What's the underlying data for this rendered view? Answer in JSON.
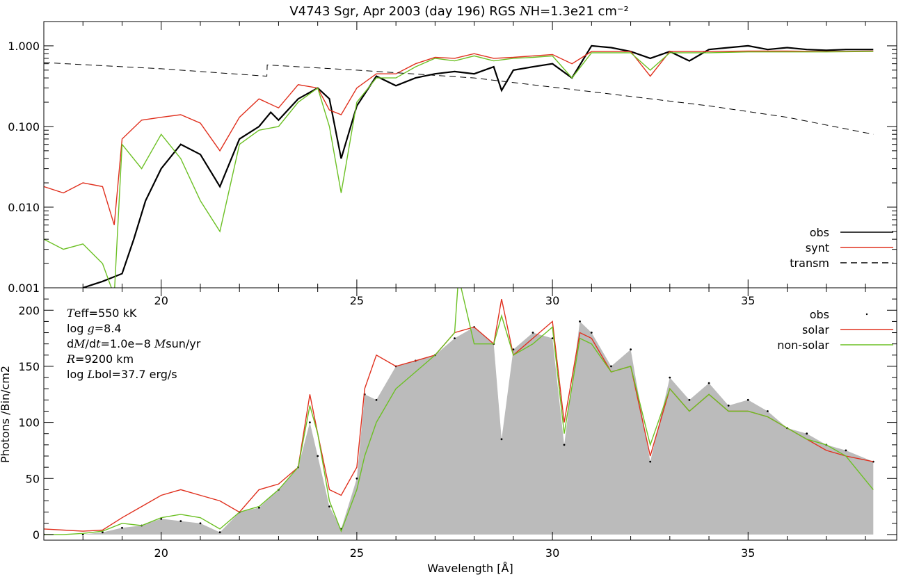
{
  "chart_data": [
    {
      "type": "line",
      "title": "V4743 Sgr, Apr 2003 (day 196) RGS  NH=1.3e21 cm⁻²",
      "title_parts": {
        "prefix": "V4743 Sgr, Apr 2003 (day 196) RGS  ",
        "sym": "N",
        "rest": "H=1.3e21 cm⁻²"
      },
      "xlabel": "",
      "ylabel": "",
      "xlim": [
        17,
        38.8
      ],
      "ylim": [
        0.001,
        2.0
      ],
      "yscale": "log",
      "xticks": [
        20,
        25,
        30,
        35
      ],
      "xtick_labels": [
        "20",
        "25",
        "30",
        "35"
      ],
      "yticks": [
        0.001,
        0.01,
        0.1,
        1.0
      ],
      "ytick_labels": [
        "0.001",
        "0.010",
        "0.100",
        "1.000"
      ],
      "grid": false,
      "legend_position": "bottom-right",
      "series": [
        {
          "name": "obs",
          "color": "#000000",
          "style": "solid",
          "x": [
            18.0,
            18.5,
            19.0,
            19.3,
            19.6,
            20.0,
            20.5,
            21.0,
            21.5,
            22.0,
            22.5,
            22.8,
            23.0,
            23.5,
            24.0,
            24.3,
            24.6,
            25.0,
            25.5,
            26.0,
            26.5,
            27.0,
            27.5,
            28.0,
            28.5,
            28.7,
            29.0,
            29.5,
            30.0,
            30.5,
            31.0,
            31.5,
            32.0,
            32.5,
            33.0,
            33.5,
            34.0,
            34.5,
            35.0,
            35.5,
            36.0,
            36.5,
            37.0,
            37.5,
            38.2
          ],
          "values": [
            0.001,
            0.0012,
            0.0015,
            0.004,
            0.012,
            0.03,
            0.06,
            0.045,
            0.018,
            0.07,
            0.1,
            0.15,
            0.12,
            0.22,
            0.3,
            0.22,
            0.04,
            0.18,
            0.42,
            0.32,
            0.4,
            0.45,
            0.48,
            0.45,
            0.55,
            0.28,
            0.5,
            0.55,
            0.6,
            0.4,
            1.0,
            0.95,
            0.85,
            0.7,
            0.85,
            0.65,
            0.9,
            0.95,
            1.0,
            0.9,
            0.95,
            0.9,
            0.88,
            0.9,
            0.9
          ]
        },
        {
          "name": "synt",
          "color": "#e0301e",
          "style": "solid",
          "x": [
            17.0,
            17.5,
            18.0,
            18.5,
            18.8,
            19.0,
            19.5,
            20.0,
            20.5,
            21.0,
            21.5,
            22.0,
            22.5,
            23.0,
            23.5,
            24.0,
            24.3,
            24.6,
            25.0,
            25.5,
            26.0,
            26.5,
            27.0,
            27.5,
            28.0,
            28.5,
            29.0,
            29.5,
            30.0,
            30.5,
            31.0,
            32.0,
            32.5,
            33.0,
            34.0,
            35.0,
            36.0,
            37.0,
            38.2
          ],
          "values": [
            0.018,
            0.015,
            0.02,
            0.018,
            0.006,
            0.07,
            0.12,
            0.13,
            0.14,
            0.11,
            0.05,
            0.13,
            0.22,
            0.17,
            0.33,
            0.3,
            0.16,
            0.14,
            0.3,
            0.45,
            0.45,
            0.6,
            0.72,
            0.7,
            0.8,
            0.7,
            0.72,
            0.75,
            0.78,
            0.6,
            0.85,
            0.85,
            0.42,
            0.85,
            0.85,
            0.86,
            0.86,
            0.85,
            0.86
          ]
        },
        {
          "name": "non-solar",
          "color": "#6cc024",
          "style": "solid",
          "x": [
            17.0,
            17.5,
            18.0,
            18.5,
            18.8,
            19.0,
            19.5,
            20.0,
            20.5,
            21.0,
            21.5,
            22.0,
            22.5,
            23.0,
            23.5,
            24.0,
            24.3,
            24.6,
            25.0,
            25.5,
            26.0,
            26.5,
            27.0,
            27.5,
            28.0,
            28.5,
            29.0,
            29.5,
            30.0,
            30.5,
            31.0,
            32.0,
            32.5,
            33.0,
            34.0,
            35.0,
            36.0,
            37.0,
            38.2
          ],
          "values": [
            0.004,
            0.003,
            0.0035,
            0.002,
            0.0008,
            0.06,
            0.03,
            0.08,
            0.04,
            0.012,
            0.005,
            0.06,
            0.09,
            0.1,
            0.2,
            0.3,
            0.1,
            0.015,
            0.2,
            0.4,
            0.4,
            0.55,
            0.7,
            0.65,
            0.75,
            0.65,
            0.7,
            0.72,
            0.75,
            0.4,
            0.82,
            0.82,
            0.5,
            0.82,
            0.82,
            0.84,
            0.84,
            0.84,
            0.85
          ]
        },
        {
          "name": "transm",
          "color": "#000000",
          "style": "dashed",
          "x": [
            17.0,
            20.0,
            22.7,
            22.71,
            25.0,
            28.0,
            31.0,
            34.0,
            36.0,
            38.2
          ],
          "values": [
            0.62,
            0.52,
            0.42,
            0.58,
            0.5,
            0.4,
            0.27,
            0.18,
            0.13,
            0.08
          ]
        }
      ]
    },
    {
      "type": "area",
      "xlabel": "Wavelength [Å]",
      "ylabel": "Photons /Bin/cm2",
      "xlim": [
        17,
        38.8
      ],
      "ylim": [
        -5,
        220
      ],
      "xticks": [
        20,
        25,
        30,
        35
      ],
      "xtick_labels": [
        "20",
        "25",
        "30",
        "35"
      ],
      "yticks": [
        0,
        50,
        100,
        150,
        200
      ],
      "ytick_labels": [
        "0",
        "50",
        "100",
        "150",
        "200"
      ],
      "grid": false,
      "legend_position": "top-right",
      "annotations": [
        {
          "sym": "T",
          "rest": "eff=550 kK"
        },
        {
          "pre": "log ",
          "sym": "g",
          "rest": "=8.4"
        },
        {
          "pre": "d",
          "sym": "M",
          "mid": "/d",
          "sym2": "t",
          "rest": "=1.0e−8 ",
          "sym3": "M",
          "rest2": "sun/yr"
        },
        {
          "sym": "R",
          "rest": "=9200 km"
        },
        {
          "pre": "log ",
          "sym": "L",
          "rest": "bol=37.7 erg/s"
        }
      ],
      "series": [
        {
          "name": "obs",
          "color": "#bbbbbb",
          "style": "filled-dots",
          "x": [
            17.0,
            18.0,
            18.5,
            19.0,
            19.5,
            20.0,
            20.5,
            21.0,
            21.5,
            22.0,
            22.5,
            23.0,
            23.5,
            23.8,
            24.0,
            24.3,
            24.6,
            25.0,
            25.2,
            25.5,
            26.0,
            26.5,
            27.0,
            27.5,
            28.0,
            28.5,
            28.7,
            29.0,
            29.5,
            30.0,
            30.3,
            30.7,
            31.0,
            31.5,
            32.0,
            32.5,
            33.0,
            33.5,
            34.0,
            34.5,
            35.0,
            35.5,
            36.0,
            36.5,
            37.0,
            37.5,
            38.2
          ],
          "values": [
            0,
            0,
            2,
            6,
            8,
            14,
            12,
            10,
            2,
            20,
            24,
            40,
            60,
            100,
            70,
            25,
            5,
            50,
            125,
            120,
            150,
            155,
            160,
            175,
            185,
            170,
            85,
            165,
            180,
            175,
            80,
            190,
            180,
            150,
            165,
            65,
            140,
            120,
            135,
            115,
            120,
            110,
            95,
            90,
            80,
            75,
            65
          ]
        },
        {
          "name": "solar",
          "color": "#e0301e",
          "style": "solid",
          "x": [
            17.0,
            17.5,
            18.0,
            18.5,
            19.0,
            19.5,
            20.0,
            20.5,
            21.0,
            21.5,
            22.0,
            22.5,
            23.0,
            23.5,
            23.8,
            24.0,
            24.3,
            24.6,
            25.0,
            25.2,
            25.5,
            26.0,
            26.5,
            27.0,
            27.5,
            28.0,
            28.5,
            28.7,
            29.0,
            29.5,
            30.0,
            30.3,
            30.7,
            31.0,
            31.5,
            32.0,
            32.5,
            33.0,
            33.5,
            34.0,
            34.5,
            35.0,
            35.5,
            36.0,
            36.5,
            37.0,
            37.5,
            38.2
          ],
          "values": [
            5,
            4,
            3,
            4,
            15,
            25,
            35,
            40,
            35,
            30,
            20,
            40,
            45,
            60,
            125,
            90,
            40,
            35,
            60,
            130,
            160,
            150,
            155,
            160,
            180,
            185,
            170,
            210,
            160,
            175,
            190,
            100,
            180,
            175,
            145,
            150,
            70,
            130,
            110,
            125,
            110,
            110,
            105,
            95,
            85,
            75,
            70,
            65
          ]
        },
        {
          "name": "non-solar",
          "color": "#6cc024",
          "style": "solid",
          "x": [
            17.0,
            17.5,
            18.0,
            18.5,
            19.0,
            19.5,
            20.0,
            20.5,
            21.0,
            21.5,
            22.0,
            22.5,
            23.0,
            23.5,
            23.8,
            24.0,
            24.3,
            24.6,
            25.0,
            25.2,
            25.5,
            26.0,
            26.5,
            27.0,
            27.5,
            27.6,
            28.0,
            28.5,
            28.7,
            29.0,
            29.5,
            30.0,
            30.3,
            30.7,
            31.0,
            31.5,
            32.0,
            32.5,
            33.0,
            33.5,
            34.0,
            34.5,
            35.0,
            35.5,
            36.0,
            36.5,
            37.0,
            37.5,
            38.2
          ],
          "values": [
            0,
            0,
            1,
            3,
            10,
            8,
            15,
            18,
            15,
            5,
            20,
            25,
            40,
            60,
            115,
            90,
            30,
            3,
            40,
            70,
            100,
            130,
            145,
            160,
            180,
            230,
            170,
            170,
            195,
            160,
            170,
            185,
            90,
            175,
            170,
            145,
            150,
            80,
            130,
            110,
            125,
            110,
            110,
            105,
            95,
            85,
            80,
            70,
            40
          ]
        }
      ]
    }
  ]
}
